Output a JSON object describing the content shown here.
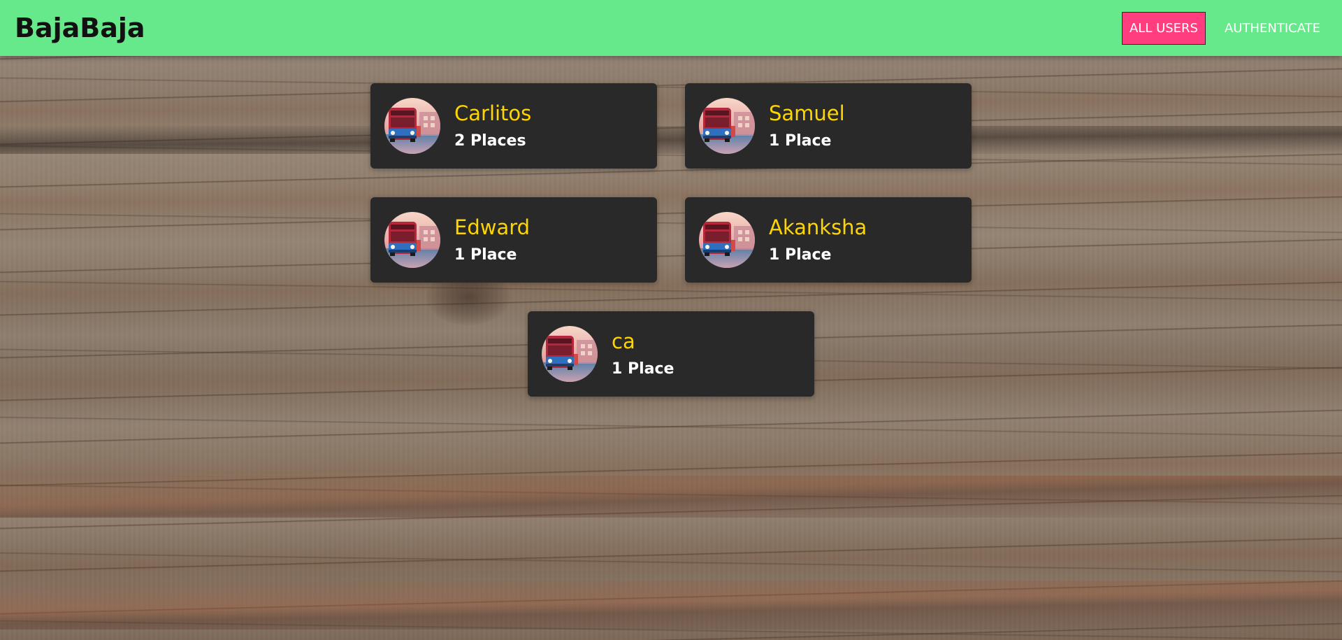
{
  "header": {
    "brand": "BajaBaja",
    "nav": {
      "all_users": "ALL USERS",
      "authenticate": "AUTHENTICATE"
    }
  },
  "colors": {
    "header_bg": "#66e98a",
    "active_nav_bg": "#ff3d7f",
    "card_bg": "#292929",
    "name_color": "#ffd500",
    "places_color": "#ffffff"
  },
  "avatar_icon": "user-photo-bus-at-sunset",
  "users": [
    {
      "name": "Carlitos",
      "places": "2 Places"
    },
    {
      "name": "Samuel",
      "places": "1 Place"
    },
    {
      "name": "Edward",
      "places": "1 Place"
    },
    {
      "name": "Akanksha",
      "places": "1 Place"
    },
    {
      "name": "ca",
      "places": "1 Place"
    }
  ]
}
